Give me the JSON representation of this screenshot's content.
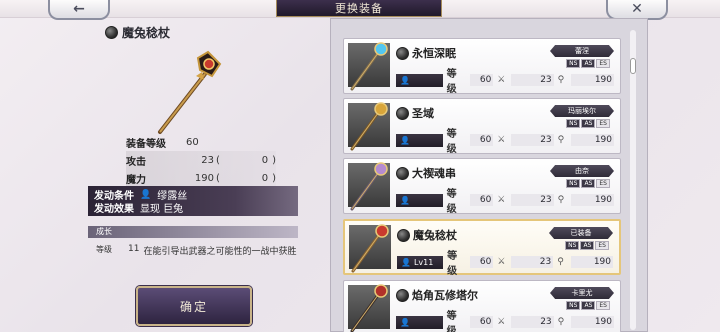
{
  "header": {
    "title": "更换装备",
    "back_icon": "←",
    "close_icon": "✕"
  },
  "current_weapon": {
    "name": "魔兔稔杖",
    "stats": {
      "equip_level_label": "装备等级",
      "equip_level": "60",
      "attack_label": "攻击",
      "attack": "23",
      "attack_bonus": "0",
      "magic_label": "魔力",
      "magic": "190",
      "magic_bonus": "0"
    },
    "effect": {
      "condition_label": "发动条件",
      "condition_value": "缪露丝",
      "effect_label": "发动效果",
      "effect_value": "显现 巨兔"
    },
    "growth": {
      "title": "成长",
      "level_label": "等级",
      "level_value": "11",
      "description": "在能引导出武器之可能性的一战中获胜"
    },
    "confirm_label": "确定"
  },
  "list": [
    {
      "name": "永恒深眠",
      "owner": "蕾涅",
      "level_label": "等级",
      "level": "60",
      "atk": "23",
      "mag": "190",
      "lv_text": "",
      "selected": false,
      "tags": [
        "NS",
        "AS",
        "ES"
      ]
    },
    {
      "name": "圣域",
      "owner": "玛丽埃尔",
      "level_label": "等级",
      "level": "60",
      "atk": "23",
      "mag": "190",
      "lv_text": "",
      "selected": false,
      "tags": [
        "NS",
        "AS",
        "ES"
      ]
    },
    {
      "name": "大禊魂串",
      "owner": "由奈",
      "level_label": "等级",
      "level": "60",
      "atk": "23",
      "mag": "190",
      "lv_text": "",
      "selected": false,
      "tags": [
        "NS",
        "AS",
        "ES"
      ]
    },
    {
      "name": "魔兔稔杖",
      "owner": "已装备",
      "level_label": "等级",
      "level": "60",
      "atk": "23",
      "mag": "190",
      "lv_text": "Lv11",
      "selected": true,
      "tags": [
        "NS",
        "AS",
        "ES"
      ]
    },
    {
      "name": "焰角瓦修塔尔",
      "owner": "卡里尤",
      "level_label": "等级",
      "level": "60",
      "atk": "23",
      "mag": "190",
      "lv_text": "",
      "selected": false,
      "tags": [
        "NS",
        "AS",
        "ES"
      ]
    }
  ]
}
